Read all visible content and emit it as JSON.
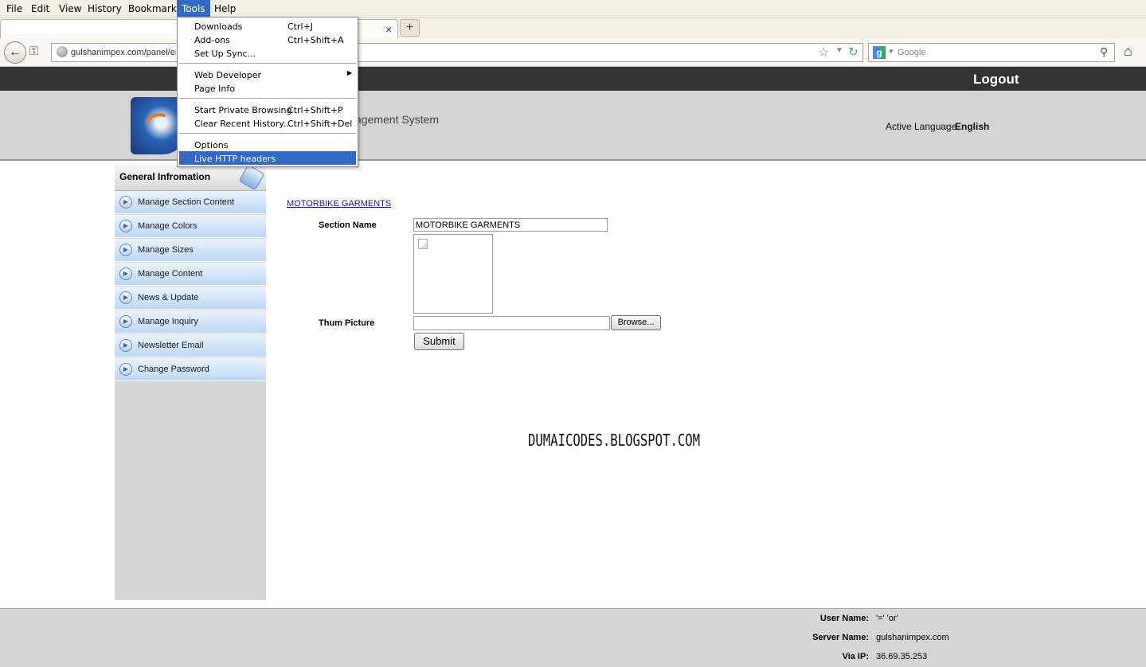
{
  "browser": {
    "menu": [
      "File",
      "Edit",
      "View",
      "History",
      "Bookmarks",
      "Tools",
      "Help"
    ],
    "active_menu": "Tools",
    "tab_close": "×",
    "new_tab": "+",
    "url": "gulshanimpex.com/panel/en",
    "search_placeholder": "Google",
    "icons": [
      "back-arrow-icon",
      "key-icon",
      "globe-icon",
      "star-icon",
      "dropdown-icon",
      "reload-icon",
      "google-icon",
      "magnifier-icon",
      "home-icon"
    ]
  },
  "tools_menu": {
    "items": [
      {
        "label": "Downloads",
        "shortcut": "Ctrl+J"
      },
      {
        "label": "Add-ons",
        "shortcut": "Ctrl+Shift+A"
      },
      {
        "label": "Set Up Sync...",
        "shortcut": ""
      },
      {
        "label": "Web Developer",
        "shortcut": "",
        "submenu": "▶"
      },
      {
        "label": "Page Info",
        "shortcut": ""
      },
      {
        "label": "Start Private Browsing",
        "shortcut": "Ctrl+Shift+P"
      },
      {
        "label": "Clear Recent History...",
        "shortcut": "Ctrl+Shift+Del"
      },
      {
        "label": "Options",
        "shortcut": ""
      },
      {
        "label": "Live HTTP headers",
        "shortcut": "",
        "highlighted": true
      }
    ]
  },
  "page": {
    "logout": "Logout",
    "site_title": "agement System",
    "active_language_label": "Active Language",
    "active_language_value": "English"
  },
  "sidebar": {
    "title": "General Infromation",
    "items": [
      "Manage Section Content",
      "Manage Colors",
      "Manage Sizes",
      "Manage Content",
      "News & Update",
      "Manage Inquiry",
      "Newsletter Email",
      "Change Password"
    ],
    "arrow_glyph": "▶"
  },
  "form": {
    "breadcrumb": "MOTORBIKE GARMENTS",
    "section_name_label": "Section Name",
    "section_name_value": "MOTORBIKE GARMENTS",
    "thumb_label": "Thum Picture",
    "browse_label": "Browse...",
    "submit_label": "Submit"
  },
  "watermark": "DUMAICODES.BLOGSPOT.COM",
  "footer": {
    "user_name_label": "User Name:",
    "user_name_value": "'=' 'or'",
    "server_name_label": "Server Name:",
    "server_name_value": "gulshanimpex.com",
    "via_ip_label": "Via IP:",
    "via_ip_value": "36.69.35.253"
  },
  "colors": {
    "menu_highlight": "#3169c6",
    "top_bar": "#333333",
    "header_bg": "#d4d4d4",
    "sidebar_item": "#bcd8f5"
  }
}
